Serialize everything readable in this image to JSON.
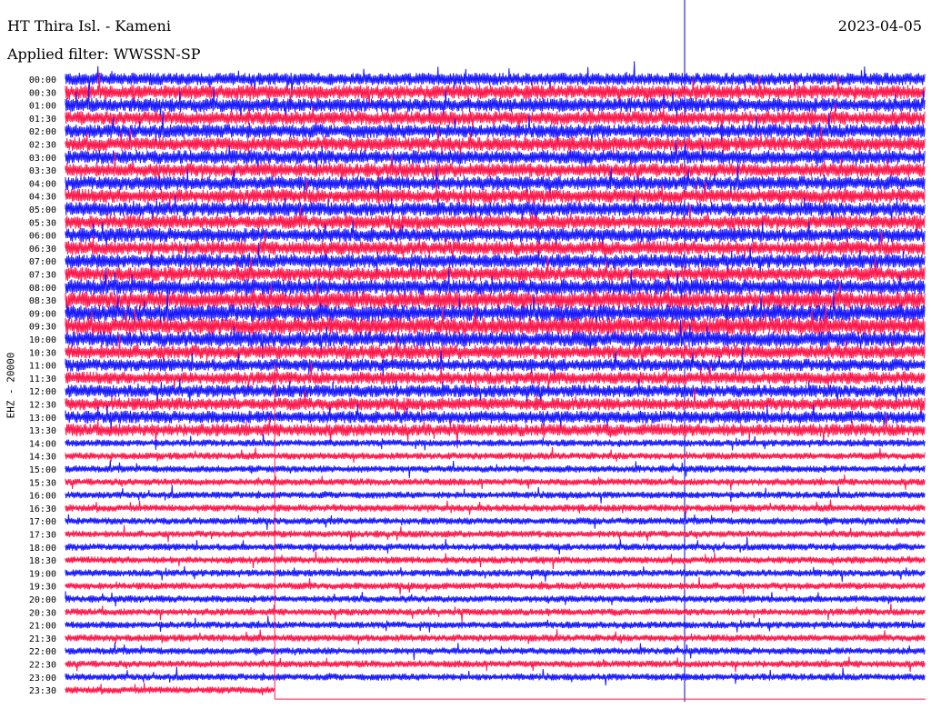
{
  "header": {
    "station": "HT Thira Isl. - Kameni",
    "date": "2023-04-05",
    "filter": "Applied filter: WWSSN-SP"
  },
  "channel_label": "EHZ - 20000",
  "colors": {
    "trace_a": "#1a1aff",
    "trace_b": "#ff1a4d",
    "marker": "#0000cc",
    "text": "#000000"
  },
  "chart_data": {
    "type": "line",
    "title": "HT Thira Isl. - Kameni",
    "subtitle": "Applied filter: WWSSN-SP",
    "ylabel": "EHZ - 20000",
    "xlabel": "",
    "grid": false,
    "x_unit": "minutes within each 30-minute line",
    "xlim": [
      0,
      30
    ],
    "row_labels": [
      "00:00",
      "00:30",
      "01:00",
      "01:30",
      "02:00",
      "02:30",
      "03:00",
      "03:30",
      "04:00",
      "04:30",
      "05:00",
      "05:30",
      "06:00",
      "06:30",
      "07:00",
      "07:30",
      "08:00",
      "08:30",
      "09:00",
      "09:30",
      "10:00",
      "10:30",
      "11:00",
      "11:30",
      "12:00",
      "12:30",
      "13:00",
      "13:30",
      "14:00",
      "14:30",
      "15:00",
      "15:30",
      "16:00",
      "16:30",
      "17:00",
      "17:30",
      "18:00",
      "18:30",
      "19:00",
      "19:30",
      "20:00",
      "20:30",
      "21:00",
      "21:30",
      "22:00",
      "22:30",
      "23:00",
      "23:30"
    ],
    "row_colors": [
      "#1a1aff",
      "#ff1a4d"
    ],
    "relative_amplitude": [
      0.9,
      1.0,
      1.0,
      1.0,
      1.0,
      1.0,
      1.0,
      1.0,
      1.0,
      1.0,
      1.0,
      1.0,
      1.0,
      1.0,
      1.0,
      1.0,
      1.1,
      1.2,
      1.2,
      1.2,
      1.1,
      1.0,
      0.9,
      0.9,
      0.9,
      0.9,
      0.9,
      0.9,
      0.5,
      0.5,
      0.5,
      0.5,
      0.5,
      0.5,
      0.5,
      0.5,
      0.5,
      0.5,
      0.5,
      0.5,
      0.5,
      0.5,
      0.5,
      0.5,
      0.5,
      0.5,
      0.5,
      0.5
    ],
    "data_end_minutes": 7.3
  }
}
